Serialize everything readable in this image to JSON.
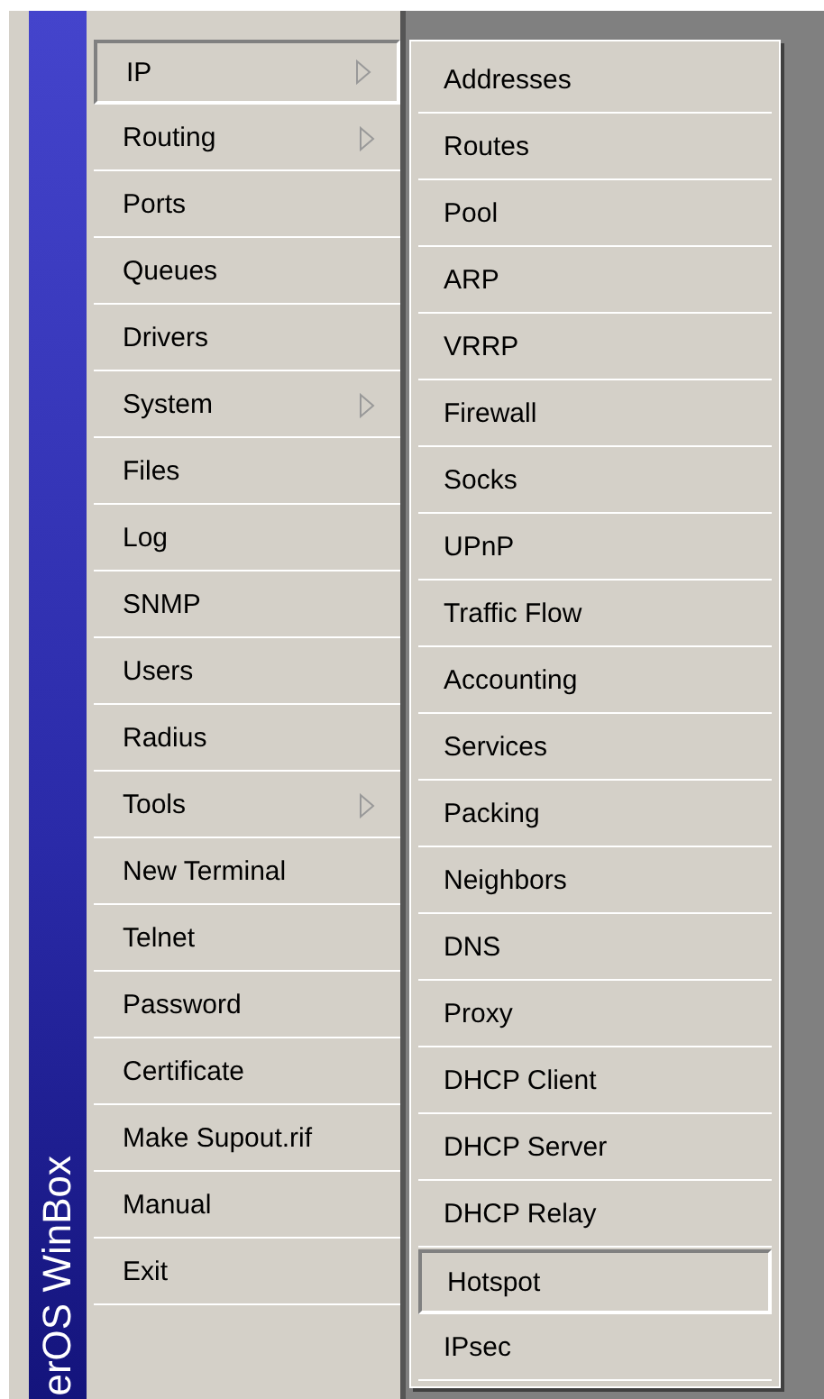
{
  "brand": {
    "text": "erOS WinBox"
  },
  "menu": {
    "items": [
      {
        "label": "IP",
        "kind": "submenu",
        "selected": true
      },
      {
        "label": "Routing",
        "kind": "submenu",
        "selected": false
      },
      {
        "label": "Ports",
        "kind": "item",
        "selected": false
      },
      {
        "label": "Queues",
        "kind": "item",
        "selected": false
      },
      {
        "label": "Drivers",
        "kind": "item",
        "selected": false
      },
      {
        "label": "System",
        "kind": "submenu",
        "selected": false
      },
      {
        "label": "Files",
        "kind": "item",
        "selected": false
      },
      {
        "label": "Log",
        "kind": "item",
        "selected": false
      },
      {
        "label": "SNMP",
        "kind": "item",
        "selected": false
      },
      {
        "label": "Users",
        "kind": "item",
        "selected": false
      },
      {
        "label": "Radius",
        "kind": "item",
        "selected": false
      },
      {
        "label": "Tools",
        "kind": "submenu",
        "selected": false
      },
      {
        "label": "New Terminal",
        "kind": "item",
        "selected": false
      },
      {
        "label": "Telnet",
        "kind": "item",
        "selected": false
      },
      {
        "label": "Password",
        "kind": "item",
        "selected": false
      },
      {
        "label": "Certificate",
        "kind": "item",
        "selected": false
      },
      {
        "label": "Make Supout.rif",
        "kind": "item",
        "selected": false
      },
      {
        "label": "Manual",
        "kind": "item",
        "selected": false
      },
      {
        "label": "Exit",
        "kind": "item",
        "selected": false
      }
    ]
  },
  "submenu": {
    "items": [
      {
        "label": "Addresses",
        "selected": false
      },
      {
        "label": "Routes",
        "selected": false
      },
      {
        "label": "Pool",
        "selected": false
      },
      {
        "label": "ARP",
        "selected": false
      },
      {
        "label": "VRRP",
        "selected": false
      },
      {
        "label": "Firewall",
        "selected": false
      },
      {
        "label": "Socks",
        "selected": false
      },
      {
        "label": "UPnP",
        "selected": false
      },
      {
        "label": "Traffic Flow",
        "selected": false
      },
      {
        "label": "Accounting",
        "selected": false
      },
      {
        "label": "Services",
        "selected": false
      },
      {
        "label": "Packing",
        "selected": false
      },
      {
        "label": "Neighbors",
        "selected": false
      },
      {
        "label": "DNS",
        "selected": false
      },
      {
        "label": "Proxy",
        "selected": false
      },
      {
        "label": "DHCP Client",
        "selected": false
      },
      {
        "label": "DHCP Server",
        "selected": false
      },
      {
        "label": "DHCP Relay",
        "selected": false
      },
      {
        "label": "Hotspot",
        "selected": true
      },
      {
        "label": "IPsec",
        "selected": false
      }
    ]
  }
}
